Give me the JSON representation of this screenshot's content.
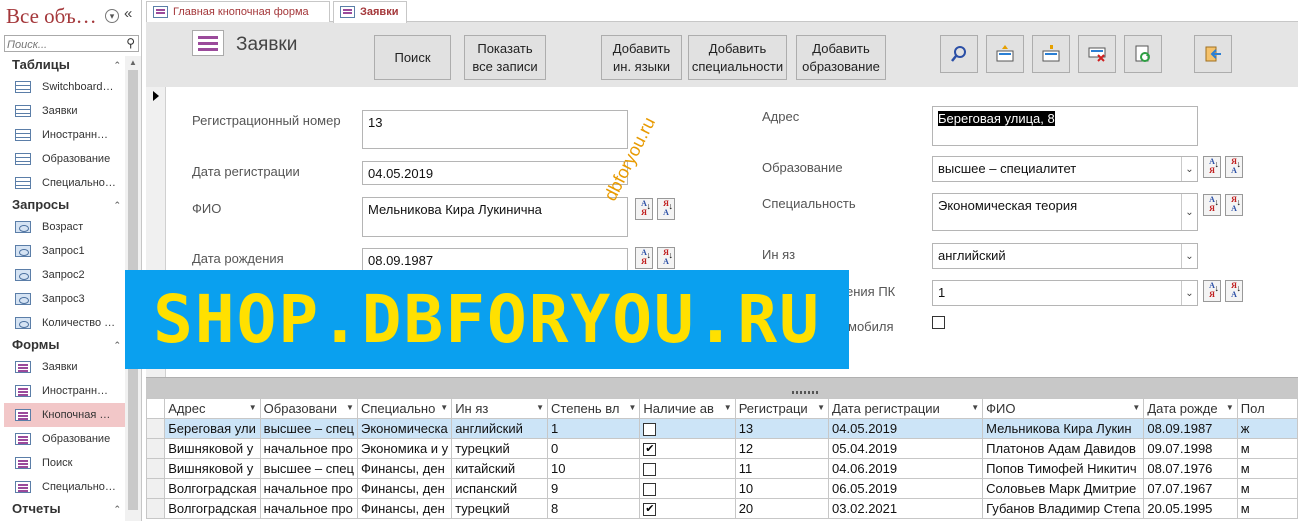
{
  "nav": {
    "title": "Все объ…",
    "search_placeholder": "Поиск...",
    "groups": [
      {
        "label": "Таблицы",
        "items": [
          "Switchboard…",
          "Заявки",
          "Иностранн…",
          "Образование",
          "Специально…"
        ]
      },
      {
        "label": "Запросы",
        "items": [
          "Возраст",
          "Запрос1",
          "Запрос2",
          "Запрос3",
          "Количество …"
        ]
      },
      {
        "label": "Формы",
        "items": [
          "Заявки",
          "Иностранн…",
          "Кнопочная …",
          "Образование",
          "Поиск",
          "Специально…"
        ]
      },
      {
        "label": "Отчеты",
        "items": []
      }
    ],
    "selected_item": "Кнопочная …"
  },
  "tabs": [
    {
      "label": "Главная кнопочная форма",
      "active": false
    },
    {
      "label": "Заявки",
      "active": true
    }
  ],
  "header": {
    "title": "Заявки",
    "buttons": {
      "search": "Поиск",
      "show_all_1": "Показать",
      "show_all_2": "все записи",
      "add_lang_1": "Добавить",
      "add_lang_2": "ин. языки",
      "add_spec_1": "Добавить",
      "add_spec_2": "специальности",
      "add_edu_1": "Добавить",
      "add_edu_2": "образование"
    },
    "icon_buttons": [
      "find-icon",
      "new-record-icon",
      "save-record-icon",
      "delete-record-icon",
      "refresh-icon",
      "exit-icon"
    ]
  },
  "form": {
    "reg_number_label": "Регистрационный номер",
    "reg_number": "13",
    "reg_date_label": "Дата регистрации",
    "reg_date": "04.05.2019",
    "fio_label": "ФИО",
    "fio": "Мельникова Кира Лукинична",
    "birth_label": "Дата рождения",
    "birth": "08.09.1987",
    "address_label": "Адрес",
    "address": "Береговая улица, 8",
    "education_label": "Образование",
    "education": "высшее – специалитет",
    "specialty_label": "Специальность",
    "specialty": "Экономическая теория",
    "lang_label": "Ин яз",
    "lang": "английский",
    "pc_label": "ения ПК",
    "pc": "1",
    "car_label": "мобиля",
    "car_checked": false
  },
  "watermark": {
    "banner": "SHOP.DBFORYOU.RU",
    "diagonal": "dbforyou.ru"
  },
  "sheet": {
    "columns": [
      "Адрес",
      "Образовани",
      "Специально",
      "Ин яз",
      "Степень вл",
      "Наличие ав",
      "Регистраци",
      "Дата регистрации",
      "ФИО",
      "Дата рожде",
      "Пол"
    ],
    "rows": [
      {
        "address": "Береговая ули",
        "edu": "высшее – спец",
        "spec": "Экономическа",
        "lang": "английский",
        "pc": "1",
        "car": false,
        "reg": "13",
        "reg_date": "04.05.2019",
        "fio": "Мельникова Кира Лукин",
        "birth": "08.09.1987",
        "sex": "ж",
        "current": true
      },
      {
        "address": "Вишняковой у",
        "edu": "начальное про",
        "spec": "Экономика и у",
        "lang": "турецкий",
        "pc": "0",
        "car": true,
        "reg": "12",
        "reg_date": "05.04.2019",
        "fio": "Платонов Адам Давидов",
        "birth": "09.07.1998",
        "sex": "м",
        "current": false
      },
      {
        "address": "Вишняковой у",
        "edu": "высшее – спец",
        "spec": "Финансы, ден",
        "lang": "китайский",
        "pc": "10",
        "car": false,
        "reg": "11",
        "reg_date": "04.06.2019",
        "fio": "Попов Тимофей Никитич",
        "birth": "08.07.1976",
        "sex": "м",
        "current": false
      },
      {
        "address": "Волгоградская",
        "edu": "начальное про",
        "spec": "Финансы, ден",
        "lang": "испанский",
        "pc": "9",
        "car": false,
        "reg": "10",
        "reg_date": "06.05.2019",
        "fio": "Соловьев Марк Дмитрие",
        "birth": "07.07.1967",
        "sex": "м",
        "current": false
      },
      {
        "address": "Волгоградская",
        "edu": "начальное про",
        "spec": "Финансы, ден",
        "lang": "турецкий",
        "pc": "8",
        "car": true,
        "reg": "20",
        "reg_date": "03.02.2021",
        "fio": "Губанов Владимир Степа",
        "birth": "20.05.1995",
        "sex": "м",
        "current": false
      }
    ]
  },
  "colors": {
    "accent": "#a4373a",
    "selected_nav": "#f2c7c8",
    "banner_bg": "#0aa0ef",
    "banner_text": "#ffe000",
    "current_row": "#cce4f7"
  }
}
